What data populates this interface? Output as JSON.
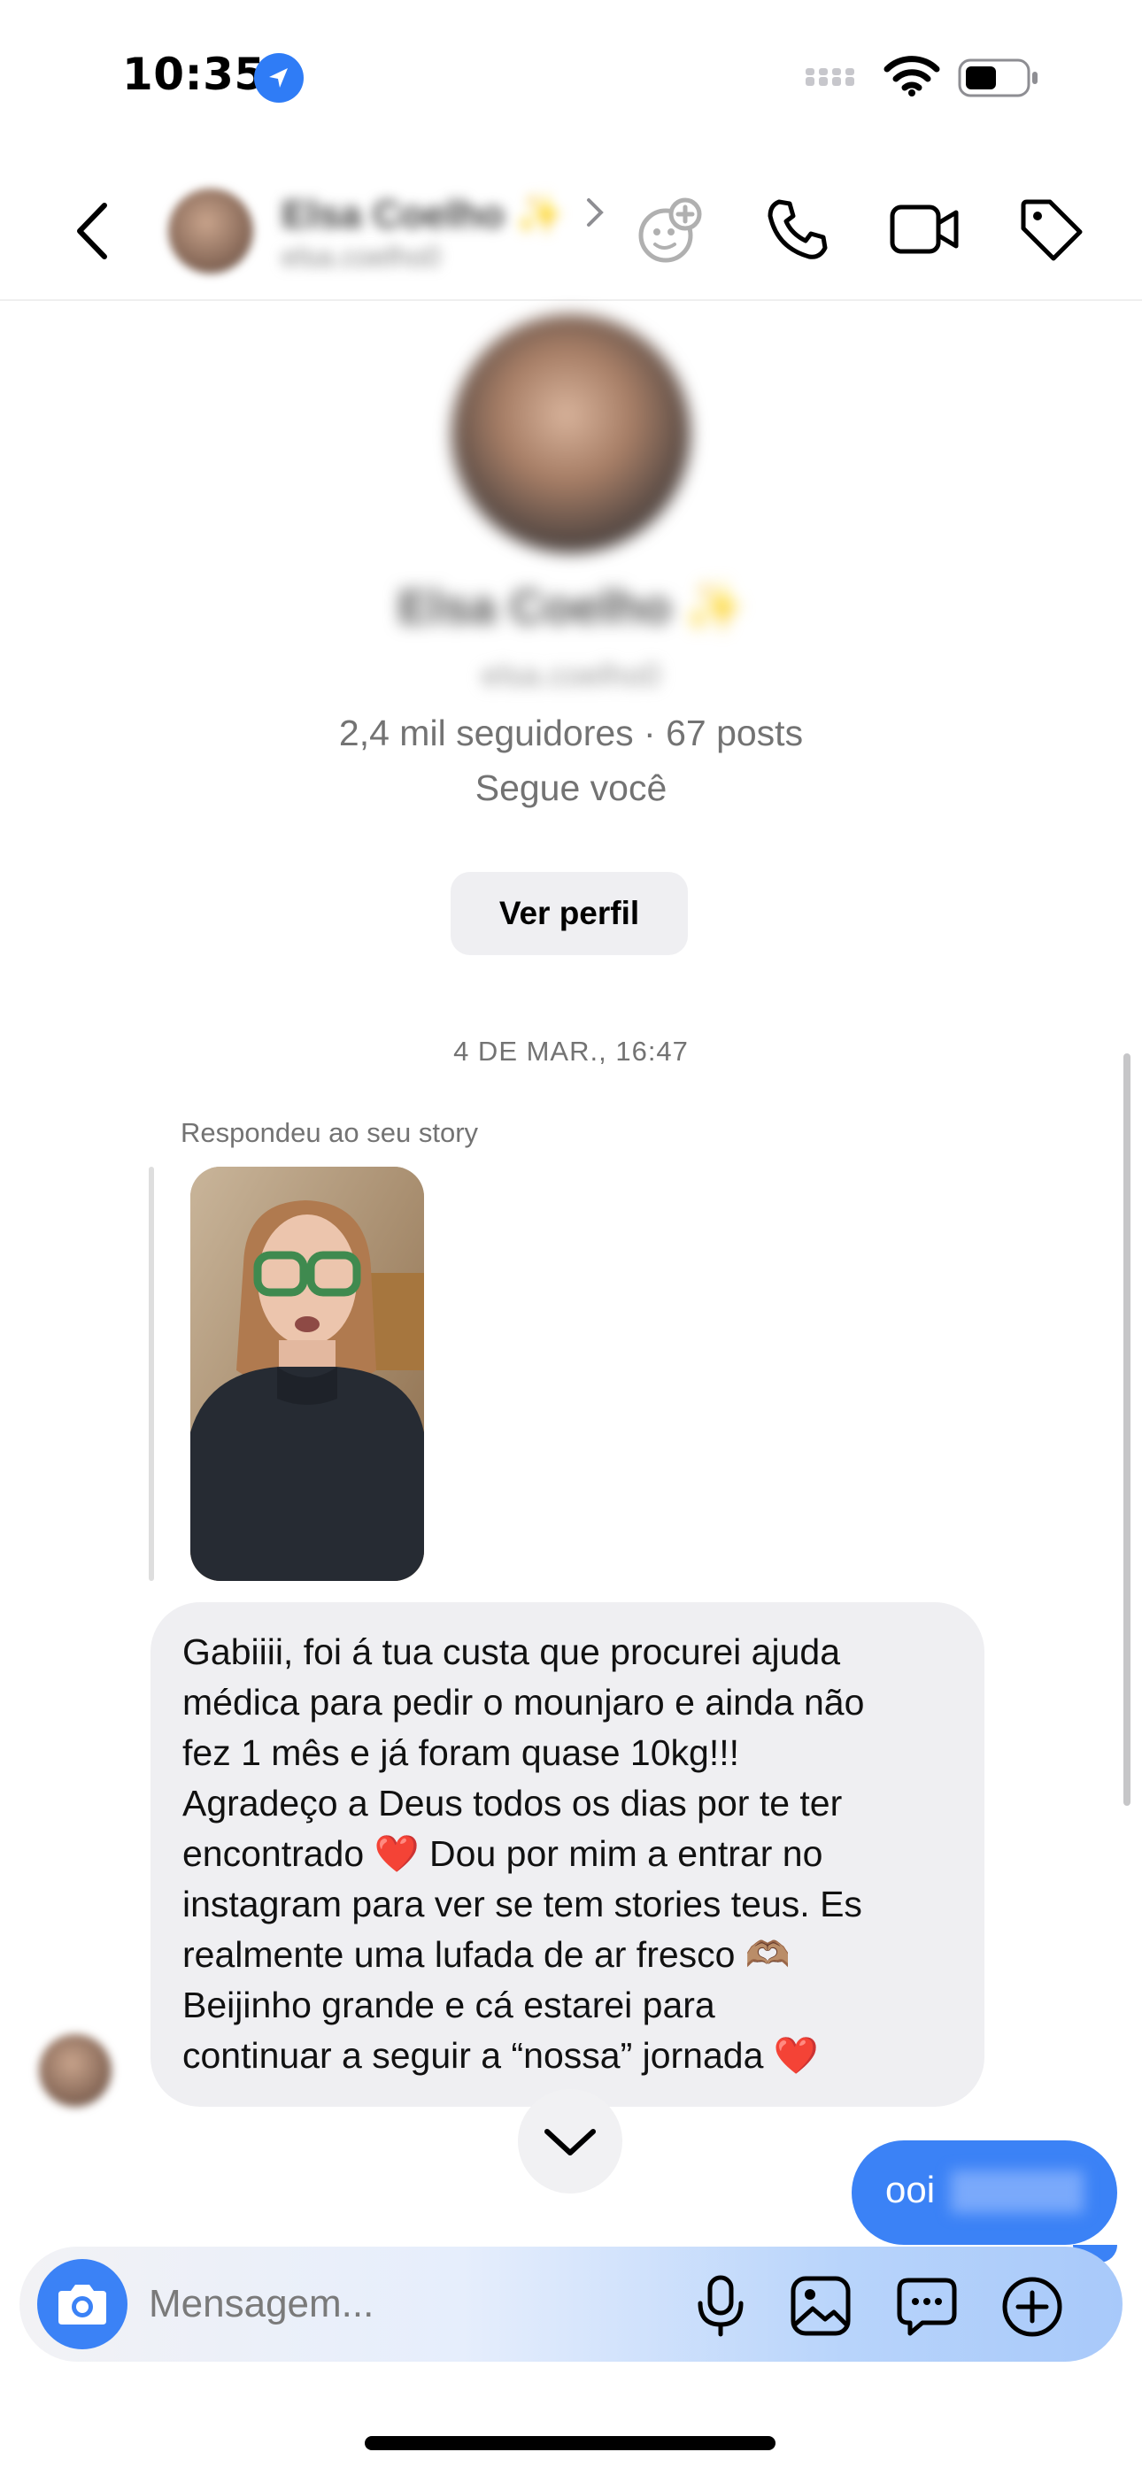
{
  "status_bar": {
    "time": "10:35"
  },
  "header": {
    "name": "Elsa Coelho ✨",
    "username": "elsa.coelho0"
  },
  "profile": {
    "name": "Elsa Coelho ✨",
    "username": "elsa.coelho0",
    "stats": "2,4 mil seguidores · 67 posts",
    "follows_you": "Segue você",
    "view_profile_label": "Ver perfil"
  },
  "conversation": {
    "timestamp": "4 DE MAR., 16:47",
    "reply_label": "Respondeu ao seu story",
    "message_lines": [
      "Gabiiii, foi á tua custa que procurei ajuda",
      "médica para pedir o mounjaro e ainda não",
      "fez 1 mês e já foram quase 10kg!!!",
      "Agradeço a Deus todos os dias por te ter",
      "encontrado",
      "Dou por mim a entrar no",
      "instagram para ver se tem stories teus. Es",
      "realmente uma lufada de ar fresco 🫶🏽",
      "Beijinho grande e cá estarei para",
      "continuar a seguir a “nossa” jornada"
    ],
    "sent_message": "ooi"
  },
  "composer": {
    "placeholder": "Mensagem..."
  },
  "colors": {
    "accent": "#3b82f6",
    "bubble_received": "#efeff2",
    "secondary_text": "#737373",
    "heart": "#e02424"
  },
  "icons": [
    "location-arrow-icon",
    "cellular-signal-icon",
    "wifi-icon",
    "battery-icon",
    "back-chevron-icon",
    "chevron-right-icon",
    "sticker-add-icon",
    "phone-icon",
    "video-camera-icon",
    "tag-icon",
    "chevron-down-icon",
    "camera-icon",
    "microphone-icon",
    "gallery-icon",
    "message-bubble-icon",
    "plus-circle-icon"
  ]
}
